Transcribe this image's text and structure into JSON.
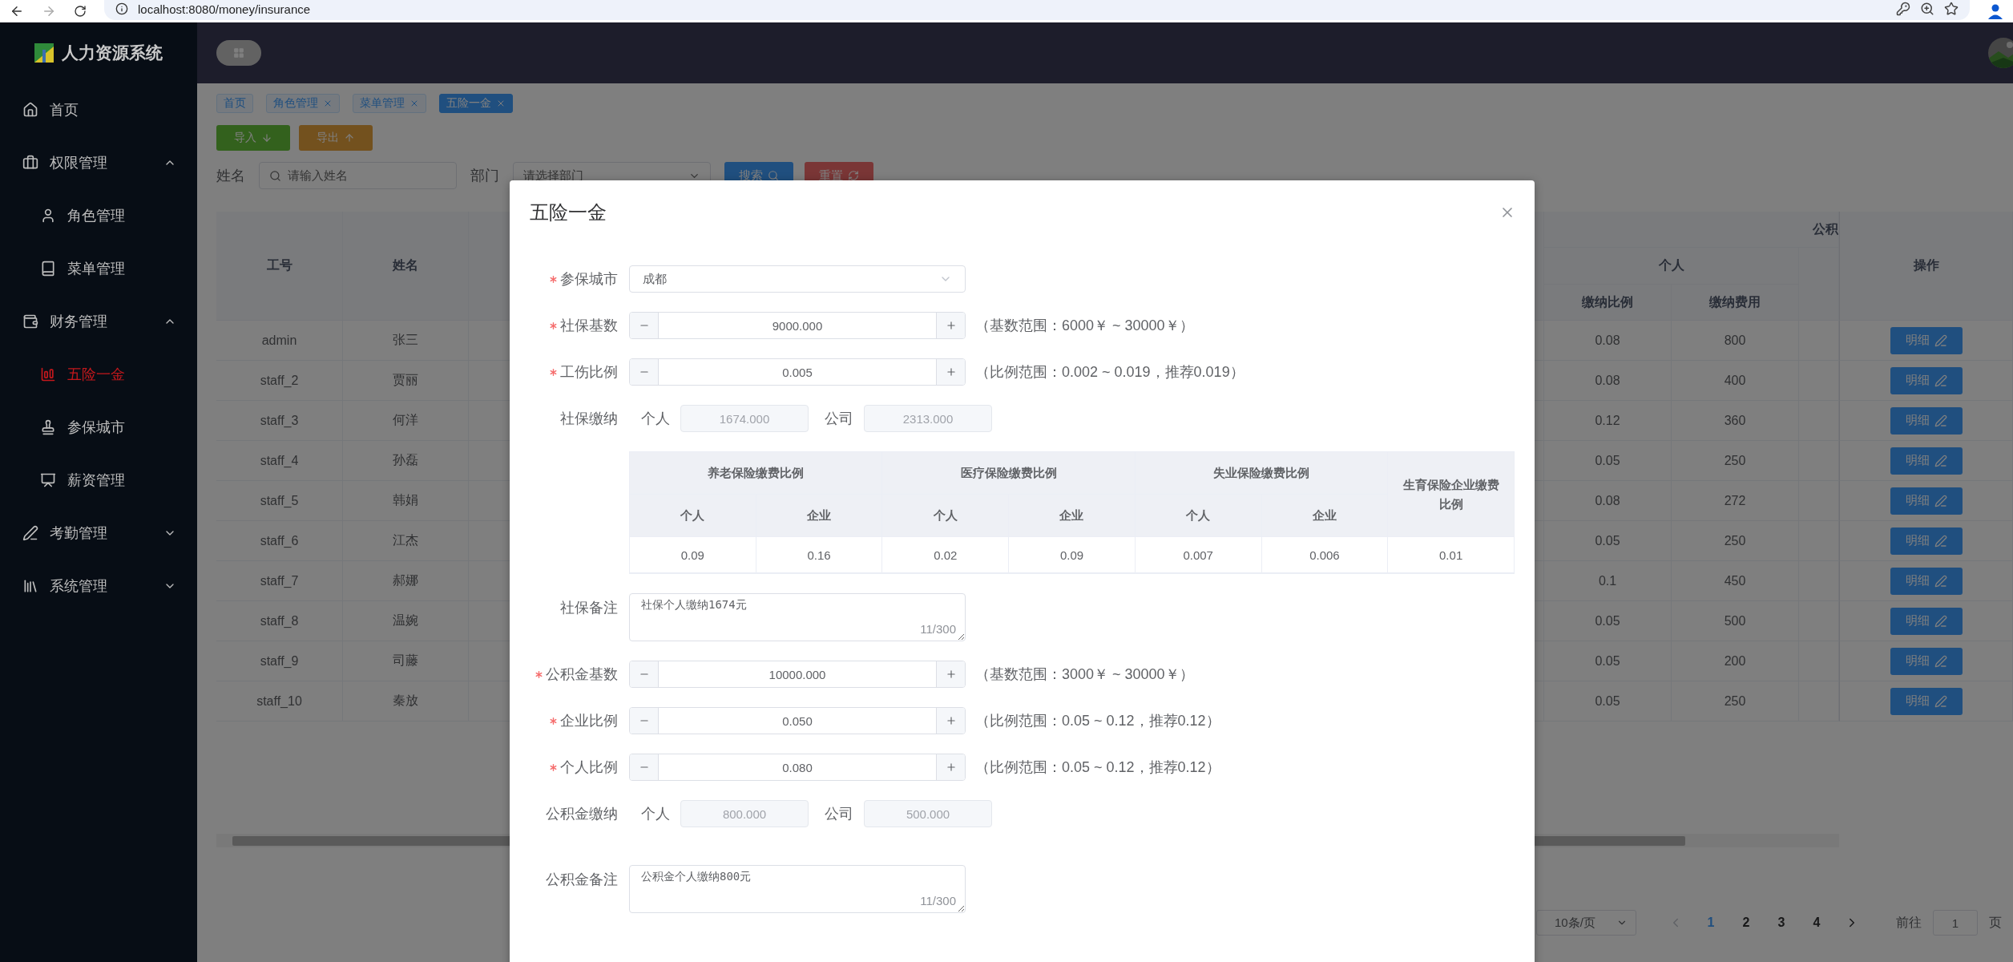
{
  "browser": {
    "url": "localhost:8080/money/insurance"
  },
  "sidebar": {
    "title": "人力资源系统",
    "items": [
      {
        "label": "首页",
        "selected": false
      },
      {
        "label": "权限管理",
        "selected": false,
        "expanded": true,
        "children": [
          {
            "label": "角色管理",
            "selected": false
          },
          {
            "label": "菜单管理",
            "selected": false
          }
        ]
      },
      {
        "label": "财务管理",
        "selected": false,
        "expanded": true,
        "children": [
          {
            "label": "五险一金",
            "selected": true
          },
          {
            "label": "参保城市",
            "selected": false
          },
          {
            "label": "薪资管理",
            "selected": false
          }
        ]
      },
      {
        "label": "考勤管理",
        "selected": false,
        "expanded": false
      },
      {
        "label": "系统管理",
        "selected": false,
        "expanded": false
      }
    ]
  },
  "tags": [
    {
      "label": "首页",
      "selected": false,
      "closable": false
    },
    {
      "label": "角色管理",
      "selected": false,
      "closable": true
    },
    {
      "label": "菜单管理",
      "selected": false,
      "closable": true
    },
    {
      "label": "五险一金",
      "selected": true,
      "closable": true
    }
  ],
  "toolbar": [
    {
      "label": "导入",
      "kind": "import"
    },
    {
      "label": "导出",
      "kind": "export"
    }
  ],
  "search": {
    "fields": [
      {
        "label": "姓名",
        "kind": "input",
        "placeholder": "请输入姓名"
      },
      {
        "label": "部门",
        "kind": "select",
        "placeholder": "请选择部门"
      }
    ],
    "buttons": [
      {
        "label": "搜索",
        "kind": "search"
      },
      {
        "label": "重置",
        "kind": "reset"
      }
    ]
  },
  "table": {
    "headers": {
      "id": "工号",
      "name": "姓名",
      "group": "公积",
      "subgroup": "个人",
      "rate": "缴纳比例",
      "fee": "缴纳费用",
      "action": "操作"
    },
    "rows": [
      {
        "id": "admin",
        "name": "张三",
        "rate": "0.08",
        "fee": "800",
        "action": "明细"
      },
      {
        "id": "staff_2",
        "name": "贾丽",
        "rate": "0.08",
        "fee": "400",
        "action": "明细"
      },
      {
        "id": "staff_3",
        "name": "何洋",
        "rate": "0.12",
        "fee": "360",
        "action": "明细"
      },
      {
        "id": "staff_4",
        "name": "孙磊",
        "rate": "0.05",
        "fee": "250",
        "action": "明细"
      },
      {
        "id": "staff_5",
        "name": "韩娟",
        "rate": "0.08",
        "fee": "272",
        "action": "明细"
      },
      {
        "id": "staff_6",
        "name": "江杰",
        "rate": "0.05",
        "fee": "250",
        "action": "明细"
      },
      {
        "id": "staff_7",
        "name": "郝娜",
        "rate": "0.1",
        "fee": "450",
        "action": "明细"
      },
      {
        "id": "staff_8",
        "name": "温婉",
        "rate": "0.05",
        "fee": "500",
        "action": "明细"
      },
      {
        "id": "staff_9",
        "name": "司藤",
        "rate": "0.05",
        "fee": "200",
        "action": "明细"
      },
      {
        "id": "staff_10",
        "name": "秦放",
        "rate": "0.05",
        "fee": "250",
        "action": "明细"
      }
    ]
  },
  "pagination": {
    "page_size": "10条/页",
    "prev_disabled": true,
    "next_disabled": false,
    "pages": [
      {
        "label": "1",
        "selected": true
      },
      {
        "label": "2",
        "selected": false
      },
      {
        "label": "3",
        "selected": false
      },
      {
        "label": "4",
        "selected": false
      }
    ],
    "goto_label": "前往",
    "goto_value": "1",
    "page_suffix": "页"
  },
  "dialog": {
    "title": "五险一金",
    "fields": [
      {
        "kind": "select",
        "label": "参保城市",
        "required": true,
        "value": "成都"
      },
      {
        "kind": "number",
        "label": "社保基数",
        "required": true,
        "value": "9000.000",
        "hint": "（基数范围：6000￥ ~ 30000￥）"
      },
      {
        "kind": "number",
        "label": "工伤比例",
        "required": true,
        "value": "0.005",
        "hint": "（比例范围：0.002 ~ 0.019，推荐0.019）"
      },
      {
        "kind": "pair",
        "label": "社保缴纳",
        "required": false,
        "parts": [
          {
            "label": "个人",
            "value": "1674.000"
          },
          {
            "label": "公司",
            "value": "2313.000"
          }
        ]
      },
      {
        "kind": "table",
        "groups": [
          {
            "label": "养老保险缴费比例",
            "columns": [
              "个人",
              "企业"
            ]
          },
          {
            "label": "医疗保险缴费比例",
            "columns": [
              "个人",
              "企业"
            ]
          },
          {
            "label": "失业保险缴费比例",
            "columns": [
              "个人",
              "企业"
            ]
          },
          {
            "label": "生育保险企业缴费比例"
          }
        ],
        "values": [
          "0.09",
          "0.16",
          "0.02",
          "0.09",
          "0.007",
          "0.006",
          "0.01"
        ]
      },
      {
        "kind": "textarea",
        "label": "社保备注",
        "required": false,
        "value": "社保个人缴纳1674元",
        "count": "11/300"
      },
      {
        "kind": "number",
        "label": "公积金基数",
        "required": true,
        "value": "10000.000",
        "hint": "（基数范围：3000￥ ~ 30000￥）"
      },
      {
        "kind": "number",
        "label": "企业比例",
        "required": true,
        "value": "0.050",
        "hint": "（比例范围：0.05 ~ 0.12，推荐0.12）"
      },
      {
        "kind": "number",
        "label": "个人比例",
        "required": true,
        "value": "0.080",
        "hint": "（比例范围：0.05 ~ 0.12，推荐0.12）"
      },
      {
        "kind": "pair",
        "label": "公积金缴纳",
        "required": false,
        "parts": [
          {
            "label": "个人",
            "value": "800.000"
          },
          {
            "label": "公司",
            "value": "500.000"
          }
        ]
      },
      {
        "kind": "textarea",
        "label": "公积金备注",
        "required": false,
        "value": "公积金个人缴纳800元",
        "count": "11/300"
      }
    ]
  }
}
